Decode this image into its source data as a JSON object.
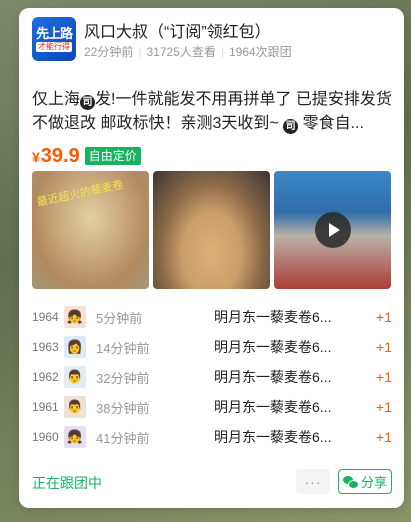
{
  "group": {
    "name": "风口大叔（“订阅”领红包）",
    "logo_line1": "先上路",
    "logo_line2": "才能行得",
    "updated": "22分钟前",
    "views": "31725人查看",
    "followers": "1964次跟团"
  },
  "post": {
    "text_before_1": "仅上海",
    "icon_glyph_1": "司",
    "text_middle": "发!一件就能发不用再拼单了 已提安排发货不做退改 邮政标快！亲测3天收到~ ",
    "icon_glyph_2": "司",
    "text_after": " 零食自...",
    "currency": "¥",
    "price": "39.9",
    "price_tag": "自由定价"
  },
  "images": [
    {
      "name": "product-photo-1",
      "note": "最近超火的藜麦卷"
    },
    {
      "name": "product-photo-2"
    },
    {
      "name": "product-video"
    }
  ],
  "orders": [
    {
      "num": "1964",
      "avatar": "👧",
      "avatar_bg": "#f6e2d0",
      "time": "5分钟前",
      "product": "明月东一藜麦卷6...",
      "qty": "+1"
    },
    {
      "num": "1963",
      "avatar": "👩",
      "avatar_bg": "#dfe9f5",
      "time": "14分钟前",
      "product": "明月东一藜麦卷6...",
      "qty": "+1"
    },
    {
      "num": "1962",
      "avatar": "👨",
      "avatar_bg": "#e2ecf2",
      "time": "32分钟前",
      "product": "明月东一藜麦卷6...",
      "qty": "+1"
    },
    {
      "num": "1961",
      "avatar": "👨",
      "avatar_bg": "#ece3d6",
      "time": "38分钟前",
      "product": "明月东一藜麦卷6...",
      "qty": "+1"
    },
    {
      "num": "1960",
      "avatar": "👧",
      "avatar_bg": "#e6def2",
      "time": "41分钟前",
      "product": "明月东一藜麦卷6...",
      "qty": "+1"
    }
  ],
  "footer": {
    "status": "正在跟团中",
    "more": "···",
    "share": "分享"
  },
  "colors": {
    "accent_green": "#19b35f",
    "price_orange": "#ff5a00"
  }
}
